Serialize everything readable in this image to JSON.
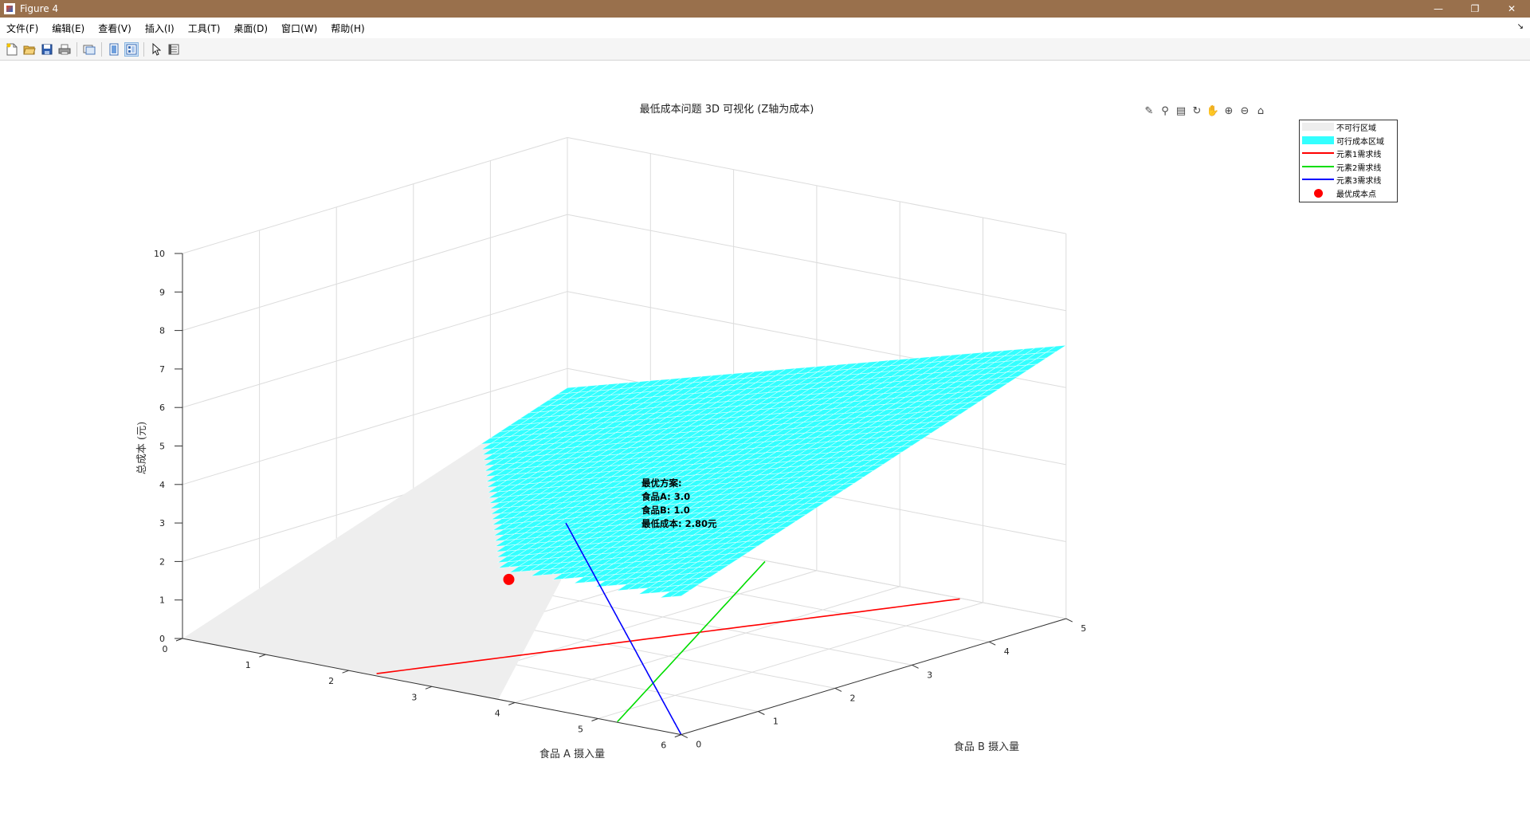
{
  "window": {
    "title": "Figure 4",
    "minimize": "—",
    "restore": "❐",
    "close": "✕"
  },
  "menu": [
    "文件(F)",
    "编辑(E)",
    "查看(V)",
    "插入(I)",
    "工具(T)",
    "桌面(D)",
    "窗口(W)",
    "帮助(H)"
  ],
  "menu_arrow": "↘",
  "toolbar": [
    "new-figure-icon",
    "open-file-icon",
    "save-icon",
    "print-icon",
    "link-plot-icon",
    "hide-plot-tools-icon",
    "show-plot-tools-icon",
    "edit-plot-icon",
    "property-inspector-icon"
  ],
  "axes_toolbar": [
    "export-icon",
    "brush-icon",
    "data-tips-icon",
    "rotate-3d-icon",
    "pan-icon",
    "zoom-in-icon",
    "zoom-out-icon",
    "home-icon"
  ],
  "colors": {
    "feasible": "#33ffff",
    "infeasible": "#eeeeee",
    "line1": "#ff0000",
    "line2": "#00dd00",
    "line3": "#0000ff",
    "optimum": "#ff0000"
  },
  "chart_data": {
    "type": "surface3d",
    "title": "最低成本问题 3D 可视化 (Z轴为成本)",
    "xlabel": "食品 A 摄入量",
    "ylabel": "食品 B 摄入量",
    "zlabel": "总成本 (元)",
    "xlim": [
      0,
      6
    ],
    "ylim": [
      0,
      5
    ],
    "zlim": [
      0,
      10
    ],
    "xticks": [
      "0",
      "1",
      "2",
      "3",
      "4",
      "5",
      "6"
    ],
    "yticks": [
      "0",
      "1",
      "2",
      "3",
      "4",
      "5"
    ],
    "zticks": [
      "0",
      "1",
      "2",
      "3",
      "4",
      "5",
      "6",
      "7",
      "8",
      "9",
      "10"
    ],
    "legend": {
      "placement": "top-right",
      "entries": [
        "不可行区域",
        "可行成本区域",
        "元素1需求线",
        "元素2需求线",
        "元素3需求线",
        "最优成本点"
      ]
    },
    "optimum": {
      "x": 3.0,
      "y": 1.0,
      "z": 2.8
    },
    "annotation": [
      "最优方案:",
      "食品A: 3.0",
      "食品B: 1.0",
      "最低成本: 2.80元"
    ]
  }
}
